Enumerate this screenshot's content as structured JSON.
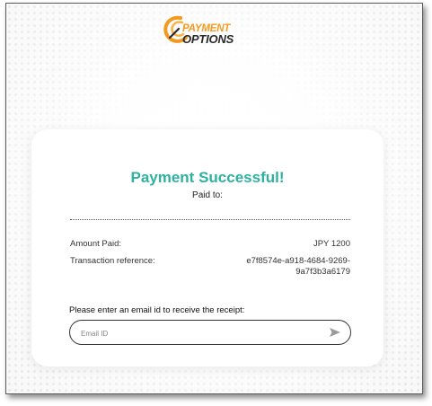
{
  "logo": {
    "line1": "PAYMENT",
    "line2": "OPTIONS"
  },
  "card": {
    "title": "Payment Successful!",
    "paid_to_label": "Paid to:",
    "amount_label": "Amount Paid:",
    "amount_value": "JPY 1200",
    "reference_label": "Transaction reference:",
    "reference_line1": "e7f8574e-a918-4684-9269-",
    "reference_line2": "9a7f3b3a6179",
    "email_prompt": "Please enter an email id to receive the receipt:",
    "email_placeholder": "Email ID",
    "email_value": ""
  },
  "colors": {
    "accent": "#2fb1a0",
    "brand_orange": "#f39a1e"
  },
  "icons": {
    "send": "send-arrow-icon",
    "logo_mark": "swirl-logo-icon"
  }
}
